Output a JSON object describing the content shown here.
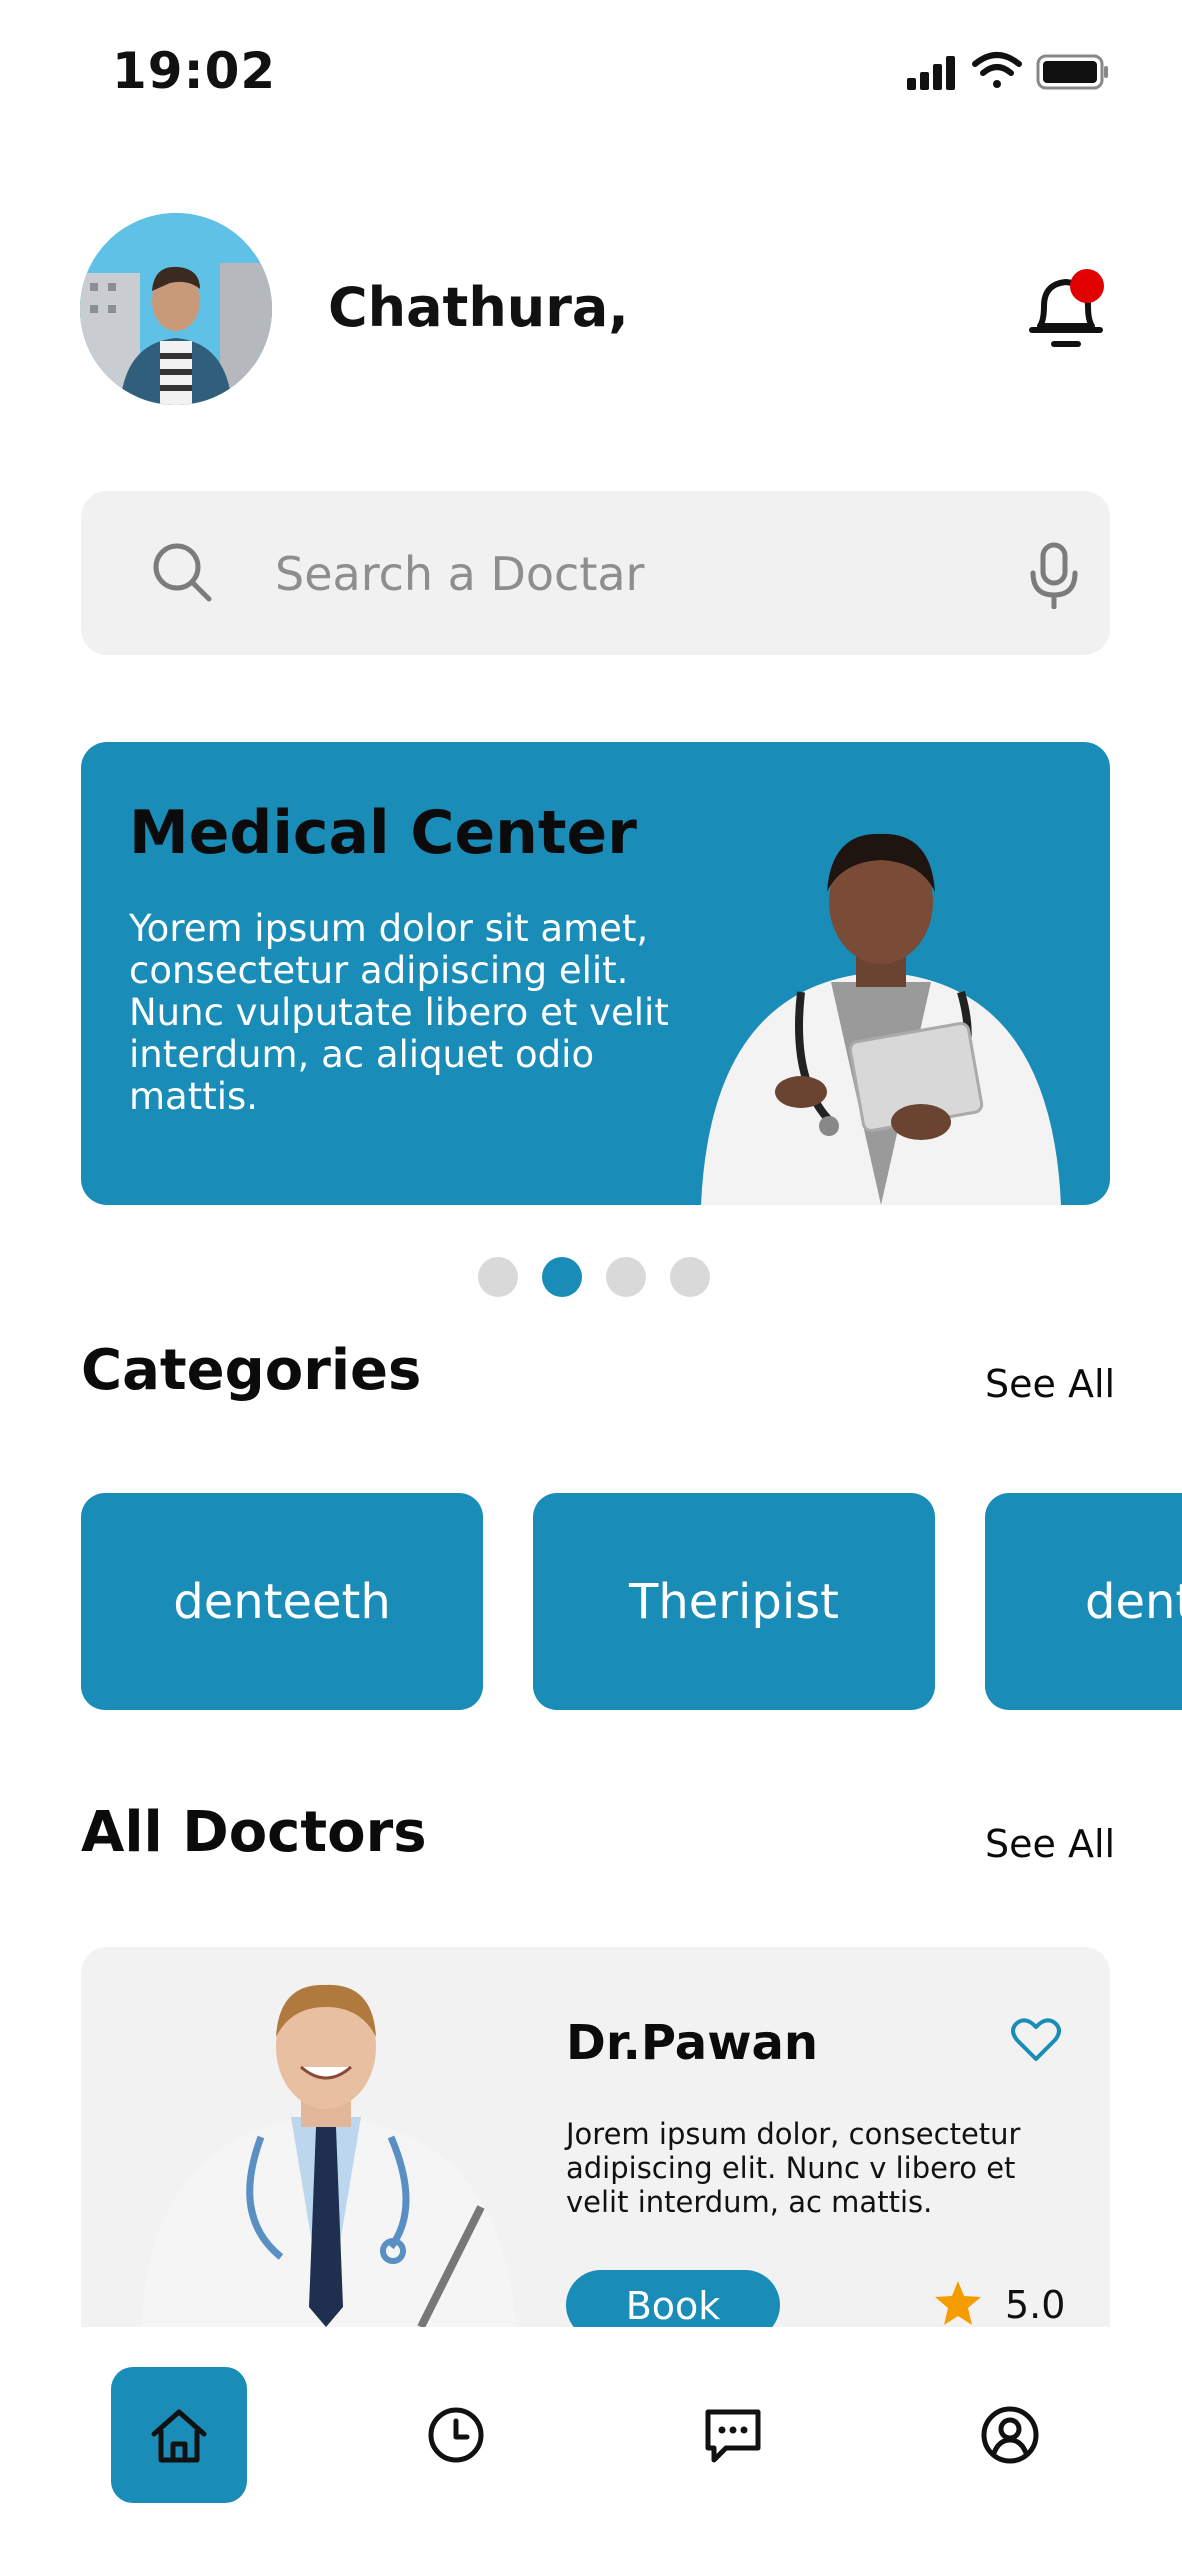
{
  "status_bar": {
    "time": "19:02"
  },
  "header": {
    "greeting": "Chathura,"
  },
  "search": {
    "placeholder": "Search a Doctar"
  },
  "banner": {
    "title": "Medical Center",
    "text": "Yorem ipsum dolor sit amet, consectetur adipiscing elit. Nunc vulputate libero et velit interdum, ac aliquet odio mattis.",
    "active_slide": 2,
    "slide_count": 4
  },
  "categories": {
    "title": "Categories",
    "see_all": "See All",
    "items": [
      "denteeth",
      "Theripist",
      "denteeth"
    ]
  },
  "doctors": {
    "title": "All Doctors",
    "see_all": "See All",
    "items": [
      {
        "name": "Dr.Pawan",
        "description": "Jorem ipsum dolor, consectetur adipiscing elit. Nunc v libero et velit interdum, ac  mattis.",
        "book_label": "Book",
        "rating": "5.0"
      }
    ]
  },
  "colors": {
    "accent": "#1a8cb8",
    "notification": "#e00000",
    "star": "#f59c00"
  },
  "bottom_nav": {
    "items": [
      {
        "icon": "home-icon",
        "active": true
      },
      {
        "icon": "clock-icon",
        "active": false
      },
      {
        "icon": "chat-icon",
        "active": false
      },
      {
        "icon": "profile-icon",
        "active": false
      }
    ]
  }
}
